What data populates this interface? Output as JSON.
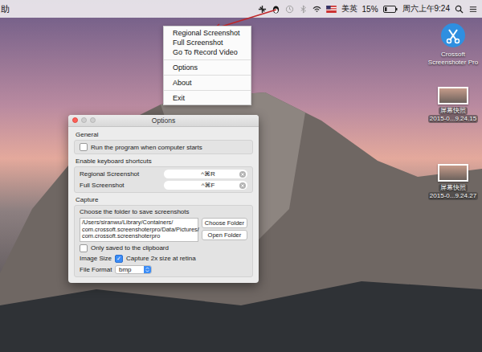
{
  "menubar": {
    "app_menu": "助",
    "battery": "15%",
    "input_source": "美英",
    "clock": "周六上午9:24"
  },
  "tray_menu": {
    "items": [
      {
        "label": "Regional Screenshot",
        "separator_before": false
      },
      {
        "label": "Full Screenshot",
        "separator_before": false
      },
      {
        "label": "Go To Record Video",
        "separator_before": false
      },
      {
        "label": "Options",
        "separator_before": true
      },
      {
        "label": "About",
        "separator_before": true
      },
      {
        "label": "Exit",
        "separator_before": true
      }
    ]
  },
  "desktop_icons": [
    {
      "kind": "app",
      "lines": [
        "Crossoft",
        "Screenshoter Pro"
      ]
    },
    {
      "kind": "file",
      "lines": [
        "屏幕快照",
        "2015-0...9.24.15"
      ]
    },
    {
      "kind": "file",
      "lines": [
        "屏幕快照",
        "2015-0...9.24.27"
      ]
    }
  ],
  "window": {
    "title": "Options",
    "general": {
      "heading": "General",
      "run_at_startup": {
        "label": "Run the program when computer starts",
        "checked": false
      }
    },
    "shortcuts": {
      "heading": "Enable keyboard shortcuts",
      "items": [
        {
          "label": "Regional Screenshot",
          "value": "^⌘R"
        },
        {
          "label": "Full Screenshot",
          "value": "^⌘F"
        }
      ]
    },
    "capture": {
      "heading": "Capture",
      "folder_label": "Choose the folder to save screenshots",
      "path_lines": [
        "/Users/siranwu/Library/Containers/",
        "com.crossoft.screenshoterpro/Data/Pictures/",
        "com.crossoft.screenshoterpro"
      ],
      "buttons": [
        "Choose Folder",
        "Open Folder"
      ],
      "clipboard_only": {
        "label": "Only saved to the clipboard",
        "checked": false
      },
      "image_size": {
        "label": "Image Size",
        "option_label": "Capture 2x size at retina",
        "checked": true
      },
      "file_format": {
        "label": "File Format",
        "value": "bmp"
      }
    }
  }
}
